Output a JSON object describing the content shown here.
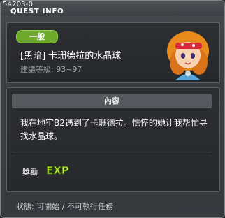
{
  "window": {
    "quest_id": "54203-0",
    "title": "QUEST INFO"
  },
  "quest": {
    "category": "一般",
    "name": "[黑暗] 卡珊德拉的水晶球",
    "level": "建議等級: 93~97"
  },
  "content": {
    "header": "內容",
    "description": "我在地牢B2遇到了卡珊德拉。憔悴的她让我帮忙寻找水晶球。"
  },
  "reward": {
    "label": "獎勵",
    "icon": "exp-icon"
  },
  "status": {
    "text": "狀態: 可開始 / 不可執行任務"
  },
  "colors": {
    "tag": "#6ea92c",
    "panel": "#2c2e32",
    "window": "#3b3e42"
  }
}
